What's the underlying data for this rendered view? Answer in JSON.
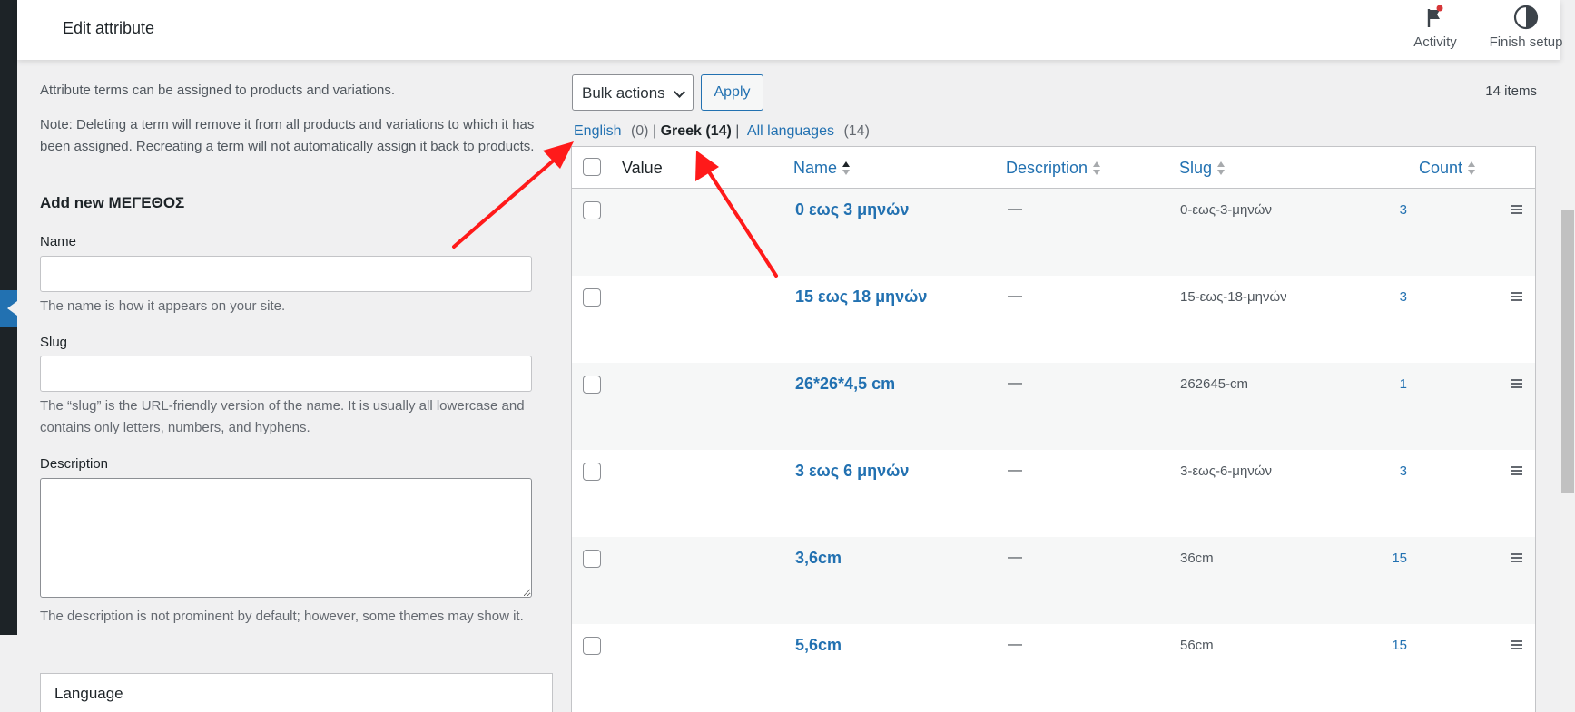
{
  "header": {
    "title": "Edit attribute",
    "activity_label": "Activity",
    "finish_setup_label": "Finish setup"
  },
  "form": {
    "intro": "Attribute terms can be assigned to products and variations.",
    "note": "Note: Deleting a term will remove it from all products and variations to which it has been assigned. Recreating a term will not automatically assign it back to products.",
    "add_new_title": "Add new ΜΕΓΕΘΟΣ",
    "name_label": "Name",
    "name_value": "",
    "name_help": "The name is how it appears on your site.",
    "slug_label": "Slug",
    "slug_value": "",
    "slug_help": "The “slug” is the URL-friendly version of the name. It is usually all lowercase and contains only letters, numbers, and hyphens.",
    "description_label": "Description",
    "description_value": "",
    "description_help": "The description is not prominent by default; however, some themes may show it.",
    "language_label": "Language"
  },
  "toolbar": {
    "bulk_actions": "Bulk actions",
    "apply": "Apply",
    "items_count": "14 items"
  },
  "language_filter": {
    "english": "English",
    "english_count": "(0)",
    "greek": "Greek",
    "greek_count": "(14)",
    "all": "All languages",
    "all_count": "(14)",
    "separator": "|"
  },
  "table": {
    "columns": {
      "value": "Value",
      "name": "Name",
      "description": "Description",
      "slug": "Slug",
      "count": "Count"
    },
    "rows": [
      {
        "name": "0 εως 3 μηνών",
        "description": "—",
        "slug": "0-εως-3-μηνών",
        "count": "3"
      },
      {
        "name": "15 εως 18 μηνών",
        "description": "—",
        "slug": "15-εως-18-μηνών",
        "count": "3"
      },
      {
        "name": "26*26*4,5 cm",
        "description": "—",
        "slug": "262645-cm",
        "count": "1"
      },
      {
        "name": "3 εως 6 μηνών",
        "description": "—",
        "slug": "3-εως-6-μηνών",
        "count": "3"
      },
      {
        "name": "3,6cm",
        "description": "—",
        "slug": "36cm",
        "count": "15"
      },
      {
        "name": "5,6cm",
        "description": "—",
        "slug": "56cm",
        "count": "15"
      }
    ]
  },
  "colors": {
    "link": "#2271b1",
    "annotation_arrow": "#ff1a1a",
    "admin_bar": "#1d2327"
  }
}
